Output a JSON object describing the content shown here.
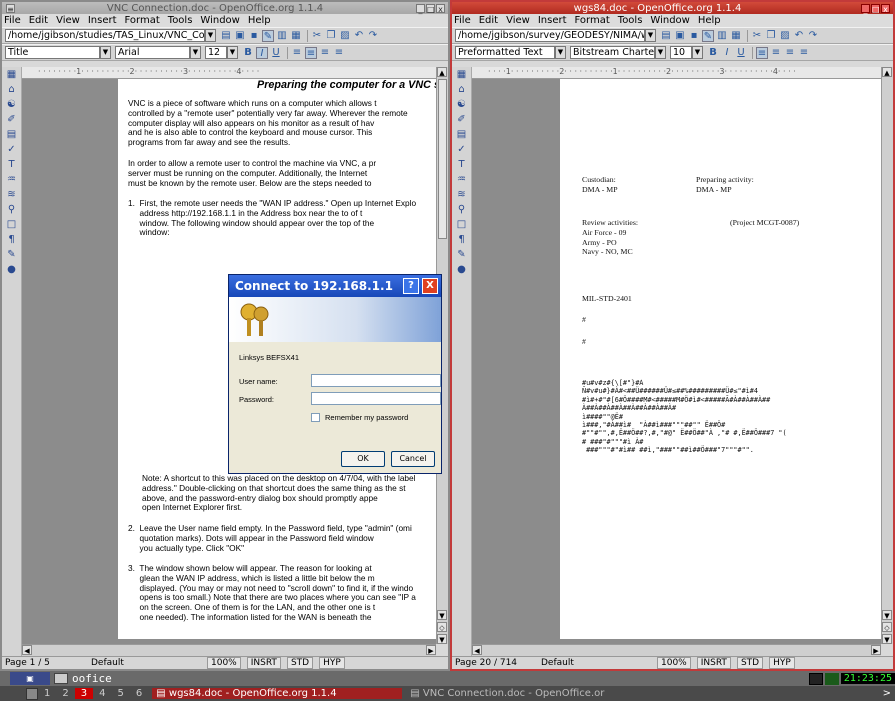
{
  "left_window": {
    "title": "VNC Connection.doc - OpenOffice.org 1.1.4",
    "title_buttons": [
      "_",
      "□",
      "x"
    ],
    "menu": [
      "File",
      "Edit",
      "View",
      "Insert",
      "Format",
      "Tools",
      "Window",
      "Help"
    ],
    "path": "/home/jgibson/studies/TAS_Linux/VNC_Con",
    "style": "Title",
    "font": "Arial",
    "size": "12",
    "format_buttons": [
      "B",
      "I",
      "U"
    ],
    "ruler": "· · · · · · · ·1· · · · · · · · · ·2· · · · · · · · · ·3· · · · · · · · · ·4· · · ·",
    "heading": "Preparing the computer for a VNC se",
    "paragraphs": [
      "VNC is a piece of software which runs on a computer which allows t\ncontrolled by a \"remote user\" potentially very far away. Wherever the remote\ncomputer display will also appears on his monitor as a result of hav\nand he is also able to control the keyboard and mouse cursor. This\nprograms from far away and see the results.",
      "In order to allow a remote user to control the machine via VNC, a pr\nserver must be running on the computer. Additionally, the Internet\nmust be known by the remote user. Below are the steps needed to",
      "1.  First, the remote user needs the \"WAN IP address.\" Open up Internet Explo\n     address http://192.168.1.1 in the Address box near the to of t\n     window. The following window should appear over the top of the\n     window:",
      "Note: A shortcut to this was placed on the desktop on 4/7/04, with the label\naddress.\" Double-clicking on that shortcut does the same thing as the st\nabove, and the password-entry dialog box should promptly appe\nopen Internet Explorer first.",
      "2.  Leave the User name field empty. In the Password field, type \"admin\" (omi\n     quotation marks). Dots will appear in the Password field window\n     you actually type. Click \"OK\"",
      "3.  The window shown below will appear. The reason for looking at\n     glean the WAN IP address, which is listed a little bit below the m\n     displayed. (You may or may not need to \"scroll down\" to find it, if the windo\n     opens is too small.) Note that there are two places where you can see \"IP a\n     on the screen. One of them is for the LAN, and the other one is t\n     one needed). The information listed for the WAN is beneath the"
    ],
    "dialog": {
      "title": "Connect to 192.168.1.1",
      "help": "?",
      "close": "X",
      "device": "Linksys BEFSX41",
      "user_label": "User name:",
      "password_label": "Password:",
      "remember": "Remember my password",
      "ok": "OK",
      "cancel": "Cancel"
    },
    "status": {
      "page": "Page 1 / 5",
      "style": "Default",
      "zoom": "100%",
      "insert": "INSRT",
      "std": "STD",
      "hyp": "HYP"
    }
  },
  "right_window": {
    "title": "wgs84.doc - OpenOffice.org 1.1.4",
    "title_buttons": [
      "_",
      "□",
      "x"
    ],
    "menu": [
      "File",
      "Edit",
      "View",
      "Insert",
      "Format",
      "Tools",
      "Window",
      "Help"
    ],
    "path": "/home/jgibson/survey/GEODESY/NIMA/wgs8",
    "style": "Preformatted Text",
    "font": "Bitstream Charte",
    "size": "10",
    "format_buttons": [
      "B",
      "I",
      "U"
    ],
    "ruler": "· · · ·1· · · · · · · · · ·2· · · · · · · · · ·1· · · · · · · · · ·2· · · · · · · · · ·3· · · · · · · · · ·4· · · ·",
    "doc": {
      "custodian_label": "Custodian:",
      "custodian_value": "DMA - MP",
      "preparing_label": "Preparing activity:",
      "preparing_value": "DMA - MP",
      "review_label": "Review activities:",
      "project": "(Project MCGT-0087)",
      "review_items": "Air Force - 09\nArmy - PO\nNavy - NO, MC",
      "standard": "MIL-STD-2401",
      "hash1": "#",
      "hash2": "#",
      "garbled": "#u#v#z#{\\[#\"}#À\nÑ#v#u#}#À#<##Ü######Ü#≤##%#########Ü#≤\"#ì#4\n#ì#+#\"#[6#Ö####M#<#####M#Ö#ì#<#####Ã#À##À##À##\nÀ##À##À##À##À##À##À##À#\nì####\"\"@Ë#\nì###,\"#À##ì#  \"À##ì###\"\"\"##\"\" Ë##Ö#\n#\"\"#\"\",#,Ë##Ö##?,#,\"#@\" Ë##Ö##\"À ,\"# #,Ë##Ö###7 \"(\n# ###\"#\"\"\"#ì À#\n ###\"\"\"#\"#ì## ##ì,\"###\"\"##ì##Ö###\"7\"\"\"#\"\"."
    },
    "status": {
      "page": "Page 20 / 714",
      "style": "Default",
      "zoom": "100%",
      "insert": "INSRT",
      "std": "STD",
      "hyp": "HYP"
    }
  },
  "panel": {
    "launcher": "oofice",
    "clock": "21:23:25",
    "workspaces": [
      "1",
      "2",
      "3",
      "4",
      "5",
      "6"
    ],
    "active_workspace": "3",
    "tasks": [
      "wgs84.doc - OpenOffice.org 1.1.4",
      "VNC Connection.doc - OpenOffice.or"
    ],
    "more": ">"
  }
}
